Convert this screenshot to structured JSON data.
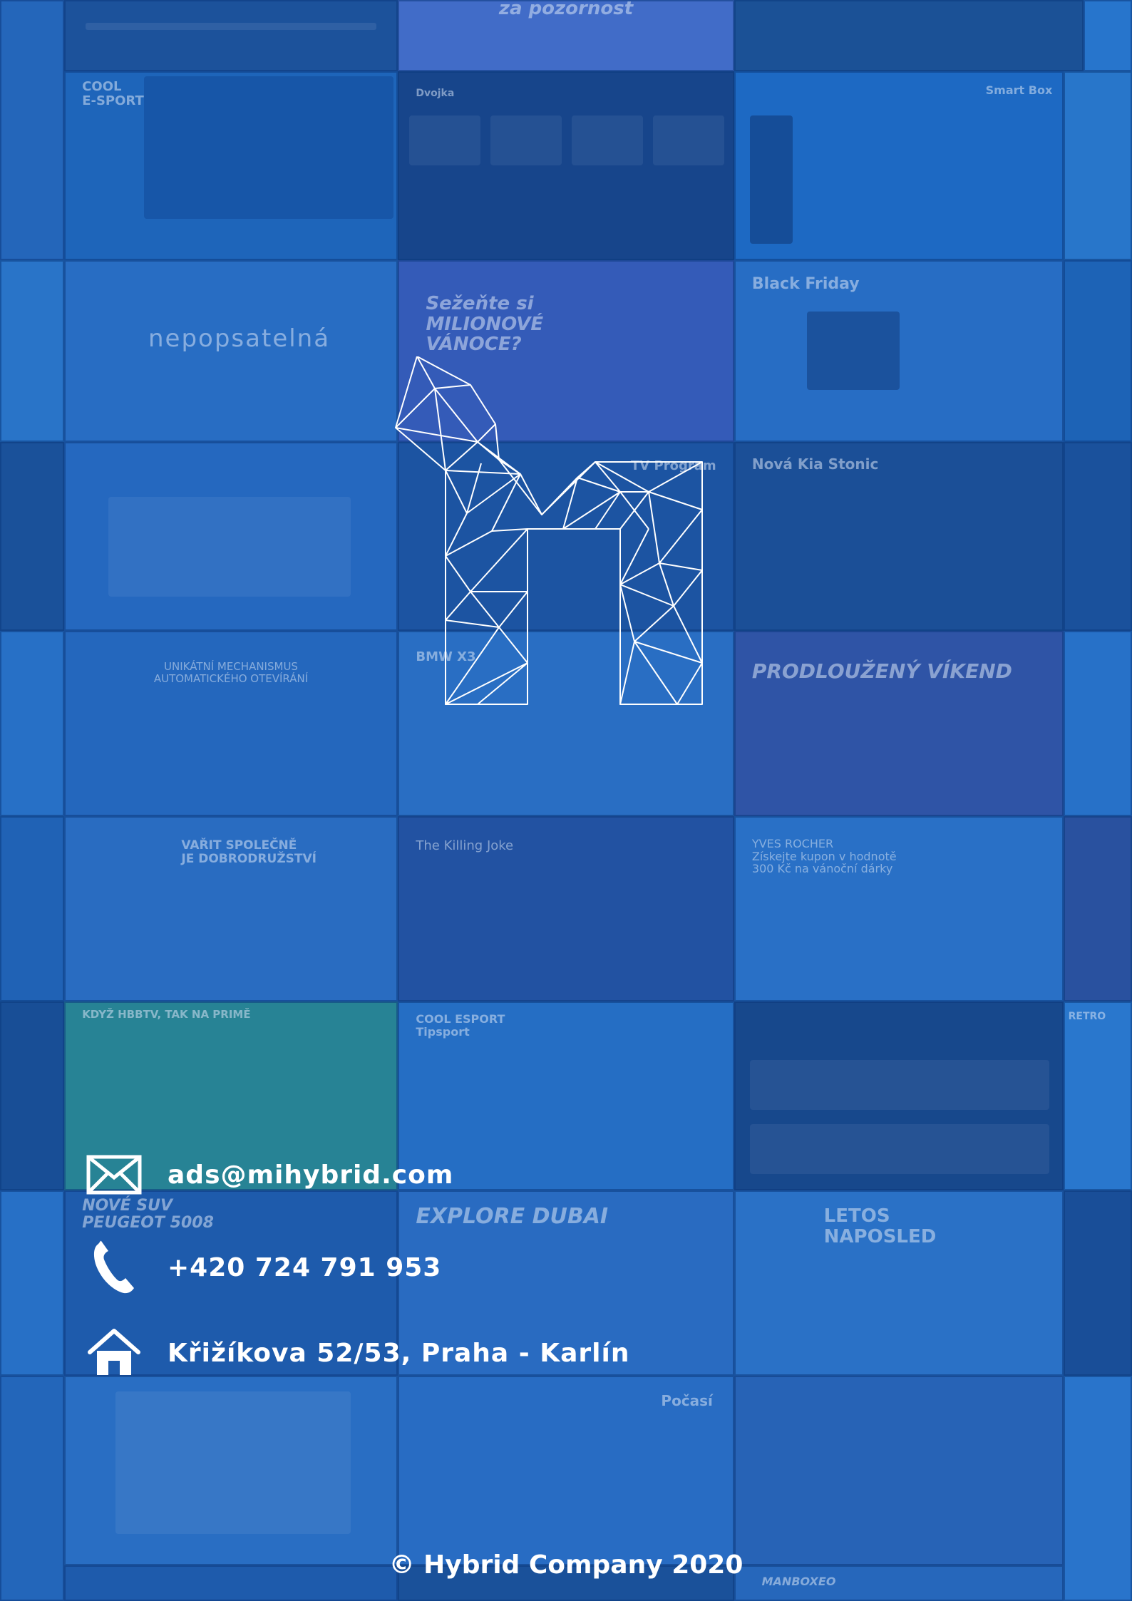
{
  "colors": {
    "background": "#1f5fae",
    "text": "#ffffff",
    "tile_palette": [
      "#2a6cc0",
      "#1e5aa8",
      "#3579cc",
      "#174f98",
      "#2c72c4",
      "#2466b6"
    ]
  },
  "contact": {
    "email": {
      "icon": "envelope-icon",
      "text": "ads@mihybrid.com"
    },
    "phone": {
      "icon": "phone-icon",
      "text": "+420 724 791 953"
    },
    "address": {
      "icon": "home-icon",
      "text": "Křižíkova 52/53, Praha - Karlín"
    }
  },
  "logo": {
    "icon": "hybrid-logo-icon"
  },
  "footer": {
    "text": "© Hybrid Company 2020"
  },
  "tiles": [
    {
      "text": "za pozornost"
    },
    {
      "text": "COOL\nE-SPORT"
    },
    {
      "text": "Dvojka"
    },
    {
      "text": "Smart Box"
    },
    {
      "text": "nepopsatelná"
    },
    {
      "text": "Sežeňte si\nMILIONOVÉ\nVÁNOCE?"
    },
    {
      "text": "Black Friday"
    },
    {
      "text": "TV Program"
    },
    {
      "text": "Nová Kia Stonic"
    },
    {
      "text": "UNIKÁTNÍ MECHANISMUS\nAUTOMATICKÉHO OTEVÍRÁNÍ"
    },
    {
      "text": "BMW X3"
    },
    {
      "text": "PRODLOUŽENÝ VÍKEND"
    },
    {
      "text": "VAŘIT SPOLEČNĚ\nJE DOBRODRUŽSTVÍ"
    },
    {
      "text": "The Killing Joke"
    },
    {
      "text": "YVES ROCHER\nZískejte kupon v hodnotě\n300 Kč na vánoční dárky"
    },
    {
      "text": "KDYŽ HBBTV, TAK NA PRIMĚ"
    },
    {
      "text": "COOL ESPORT\nTipsport"
    },
    {
      "text": "RETRO"
    },
    {
      "text": "NOVÉ SUV\nPEUGEOT 5008"
    },
    {
      "text": "EXPLORE DUBAI"
    },
    {
      "text": "LETOS\nNAPOSLED"
    },
    {
      "text": "Počasí"
    },
    {
      "text": "MANBOXEO"
    }
  ]
}
